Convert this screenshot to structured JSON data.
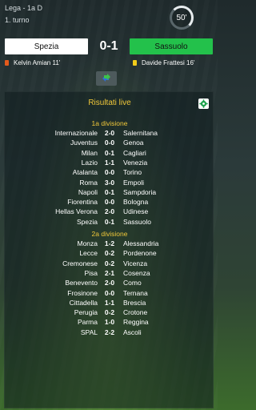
{
  "header": {
    "league": "Lega - 1a D",
    "round": "1. turno",
    "minute": "50'"
  },
  "match": {
    "home_team": "Spezia",
    "away_team": "Sassuolo",
    "score": "0-1",
    "home_color": "#ffffff",
    "away_color": "#23c14b",
    "events": {
      "home": {
        "card": "red",
        "text": "Kelvin Amian 11'"
      },
      "away": {
        "card": "yellow",
        "text": "Davide Frattesi 16'"
      }
    },
    "sub_icon": "substitution-icon"
  },
  "live_results": {
    "title": "Risultati live",
    "settings_icon": "gear-icon",
    "divisions": [
      {
        "name": "1a divisione",
        "matches": [
          {
            "home": "Internazionale",
            "score": "2-0",
            "away": "Salernitana"
          },
          {
            "home": "Juventus",
            "score": "0-0",
            "away": "Genoa"
          },
          {
            "home": "Milan",
            "score": "0-1",
            "away": "Cagliari"
          },
          {
            "home": "Lazio",
            "score": "1-1",
            "away": "Venezia"
          },
          {
            "home": "Atalanta",
            "score": "0-0",
            "away": "Torino"
          },
          {
            "home": "Roma",
            "score": "3-0",
            "away": "Empoli"
          },
          {
            "home": "Napoli",
            "score": "0-1",
            "away": "Sampdoria"
          },
          {
            "home": "Fiorentina",
            "score": "0-0",
            "away": "Bologna"
          },
          {
            "home": "Hellas Verona",
            "score": "2-0",
            "away": "Udinese"
          },
          {
            "home": "Spezia",
            "score": "0-1",
            "away": "Sassuolo"
          }
        ]
      },
      {
        "name": "2a divisione",
        "matches": [
          {
            "home": "Monza",
            "score": "1-2",
            "away": "Alessandria"
          },
          {
            "home": "Lecce",
            "score": "0-2",
            "away": "Pordenone"
          },
          {
            "home": "Cremonese",
            "score": "0-2",
            "away": "Vicenza"
          },
          {
            "home": "Pisa",
            "score": "2-1",
            "away": "Cosenza"
          },
          {
            "home": "Benevento",
            "score": "2-0",
            "away": "Como"
          },
          {
            "home": "Frosinone",
            "score": "0-0",
            "away": "Ternana"
          },
          {
            "home": "Cittadella",
            "score": "1-1",
            "away": "Brescia"
          },
          {
            "home": "Perugia",
            "score": "0-2",
            "away": "Crotone"
          },
          {
            "home": "Parma",
            "score": "1-0",
            "away": "Reggina"
          },
          {
            "home": "SPAL",
            "score": "2-2",
            "away": "Ascoli"
          }
        ]
      }
    ]
  }
}
